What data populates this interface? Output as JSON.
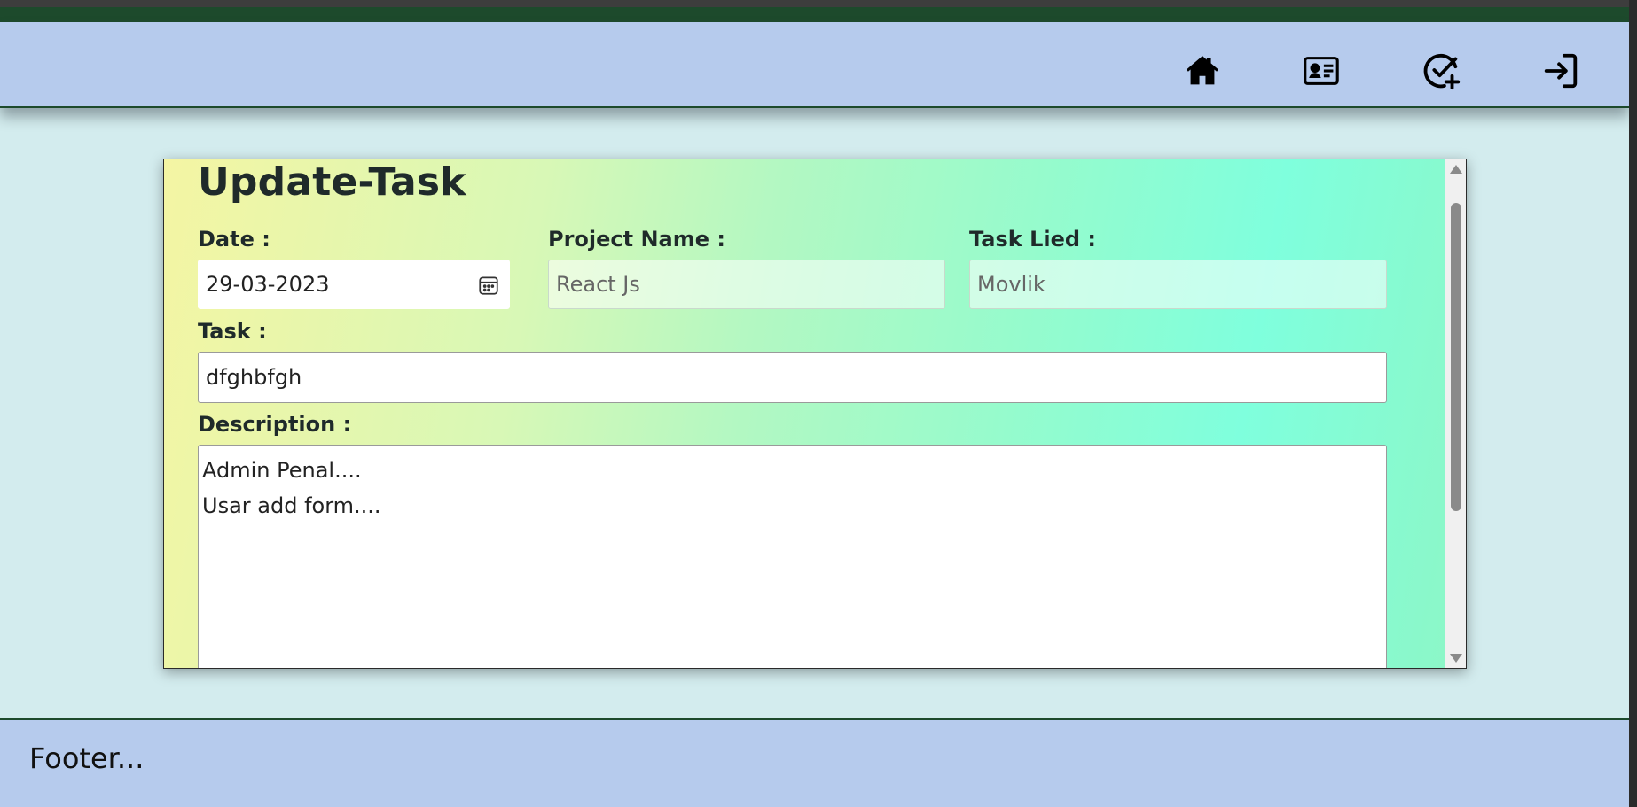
{
  "header": {
    "icons": [
      {
        "name": "home-icon"
      },
      {
        "name": "contact-card-icon"
      },
      {
        "name": "add-task-icon"
      },
      {
        "name": "login-icon"
      }
    ]
  },
  "form": {
    "title": "Update-Task",
    "date_label": "Date :",
    "date_value": "29-03-2023",
    "project_label": "Project Name :",
    "project_value": "React Js",
    "task_lied_label": "Task Lied :",
    "task_lied_value": "Movlik",
    "task_label": "Task :",
    "task_value": "dfghbfgh",
    "description_label": "Description :",
    "description_lines": [
      "Admin Penal....",
      "Usar add form...."
    ]
  },
  "footer": {
    "text": "Footer..."
  },
  "colors": {
    "header_bg": "#b6cbed",
    "top_bar": "#1d4a2c",
    "page_bg": "#d3ecee"
  }
}
